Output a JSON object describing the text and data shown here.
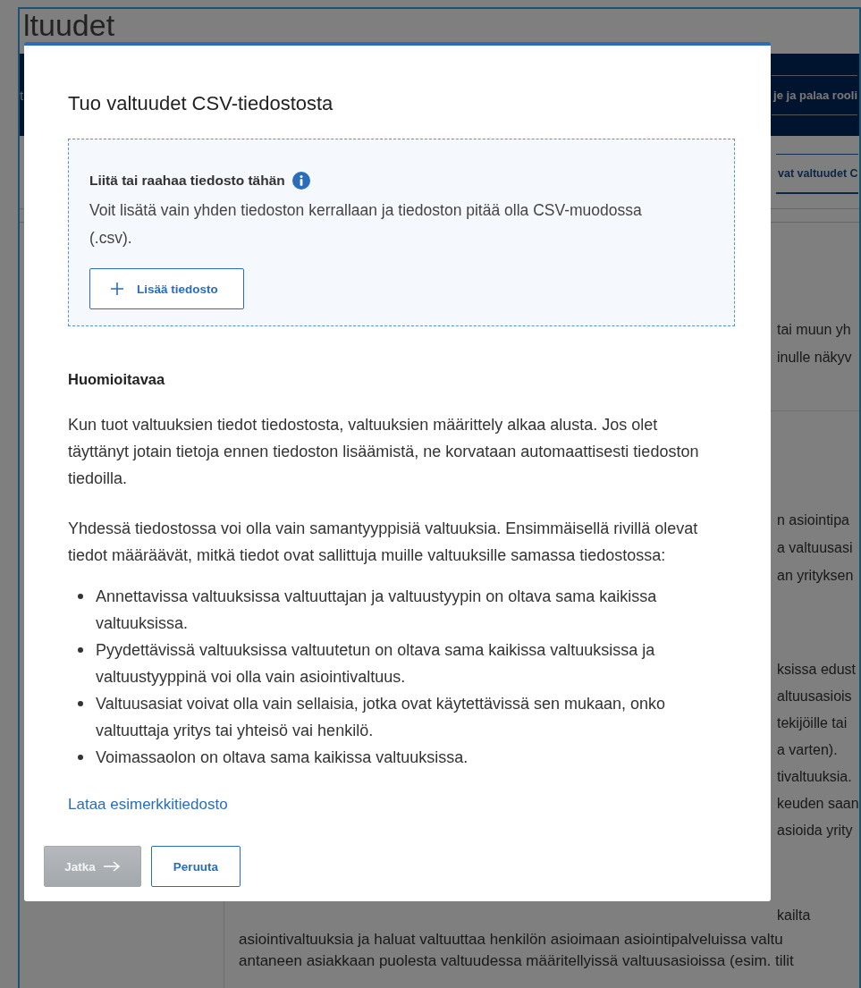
{
  "background": {
    "heading": "ltuudet",
    "nav": {
      "left_text": "t",
      "button": "je ja palaa rooli"
    },
    "tab": {
      "label": "vat valtuudet C",
      "selected": true
    },
    "fragment_groups": [
      [
        "tai muun yh",
        "inulle näkyv"
      ],
      [
        "n asiointipa",
        "a valtuusasi",
        "an yrityksen"
      ],
      [
        "ksissa edust",
        "altuusasiois",
        "tekijöille tai",
        "a varten).",
        "tivaltuuksia.",
        "keuden saan",
        "asioida yrity"
      ],
      [
        "kailta"
      ]
    ],
    "bottom_lines": [
      "asiointivaltuuksia ja haluat valtuuttaa henkilön asioimaan asiointipalveluissa valtu",
      "antaneen asiakkaan puolesta valtuudessa määritellyissä valtuusasioissa (esim. tilit"
    ]
  },
  "modal": {
    "title": "Tuo valtuudet CSV-tiedostosta",
    "dropzone": {
      "label": "Liitä tai raahaa tiedosto tähän",
      "description": "Voit lisätä vain yhden tiedoston kerrallaan ja tiedoston pitää olla CSV-muodossa (.csv).",
      "button": "Lisää tiedosto"
    },
    "notes_heading": "Huomioitavaa",
    "paragraphs": [
      "Kun tuot valtuuksien tiedot tiedostosta, valtuuksien määrittely alkaa alusta. Jos olet täyttänyt jotain tietoja ennen tiedoston lisäämistä, ne korvataan automaattisesti tiedoston tiedoilla.",
      "Yhdessä tiedostossa voi olla vain samantyyppisiä valtuuksia. Ensimmäisellä rivillä olevat tiedot määräävät, mitkä tiedot ovat sallittuja muille valtuuksille samassa tiedostossa:"
    ],
    "bullets": [
      "Annettavissa valtuuksissa valtuuttajan ja valtuustyypin on oltava sama kaikissa valtuuksissa.",
      "Pyydettävissä valtuuksissa valtuutetun on oltava sama kaikissa valtuuksissa ja valtuustyyppinä voi olla vain asiointivaltuus.",
      "Valtuusasiat voivat olla vain sellaisia, jotka ovat käytettävissä sen mukaan, onko valtuuttaja yritys tai yhteisö vai henkilö.",
      "Voimassaolon on oltava sama kaikissa valtuuksissa."
    ],
    "link": "Lataa esimerkkitiedosto",
    "buttons": [
      {
        "label": "Jatka",
        "kind": "primary",
        "disabled": true
      },
      {
        "label": "Peruuta",
        "kind": "secondary",
        "disabled": false
      }
    ]
  }
}
